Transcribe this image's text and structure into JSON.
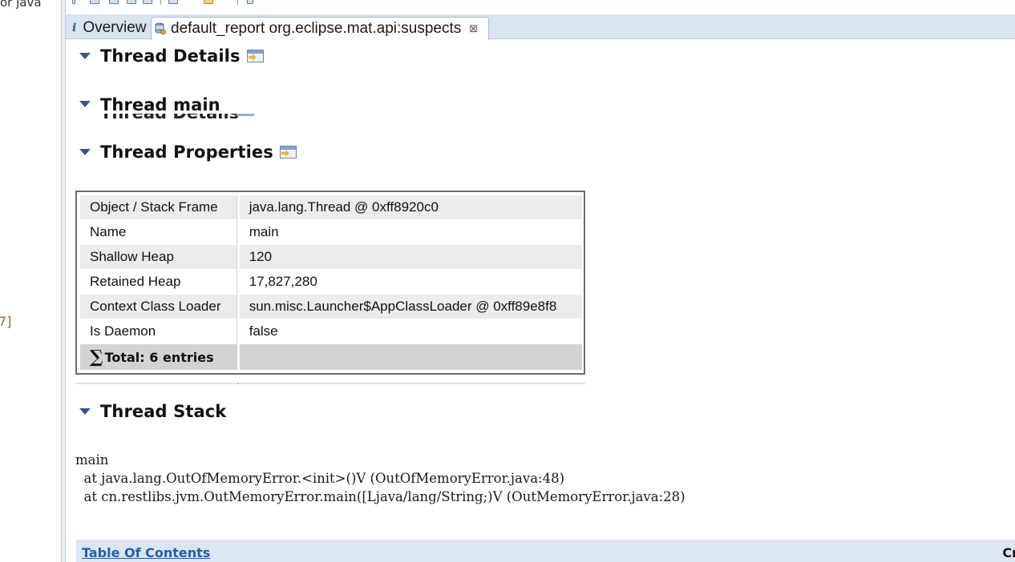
{
  "left_pane": {
    "fragment_top": "or java",
    "fragment_mid": "7]"
  },
  "tabs": [
    {
      "label": "Overview",
      "icon": "info-icon"
    },
    {
      "label": "default_report  org.eclipse.mat.api:suspects",
      "icon": "report-icon",
      "close_icon": "close-icon"
    }
  ],
  "sections": {
    "thread_details": "Thread Details",
    "thread_main": "Thread main",
    "thread_properties": "Thread Properties",
    "thread_stack": "Thread Stack"
  },
  "properties": {
    "rows": [
      {
        "key": "Object / Stack Frame",
        "value": "java.lang.Thread @ 0xff8920c0"
      },
      {
        "key": "Name",
        "value": "main"
      },
      {
        "key": "Shallow Heap",
        "value": "120"
      },
      {
        "key": "Retained Heap",
        "value": "17,827,280"
      },
      {
        "key": "Context Class Loader",
        "value": "sun.misc.Launcher$AppClassLoader @ 0xff89e8f8"
      },
      {
        "key": "Is Daemon",
        "value": "false"
      }
    ],
    "total_symbol": "∑",
    "total_label": "Total: 6 entries"
  },
  "stack": {
    "thread": "main",
    "frames": [
      "  at java.lang.OutOfMemoryError.<init>()V (OutOfMemoryError.java:48)",
      "  at cn.restlibs.jvm.OutMemoryError.main([Ljava/lang/String;)V (OutMemoryError.java:28)"
    ]
  },
  "footer": {
    "toc_link": "Table Of Contents",
    "right_fragment": "Cr"
  }
}
